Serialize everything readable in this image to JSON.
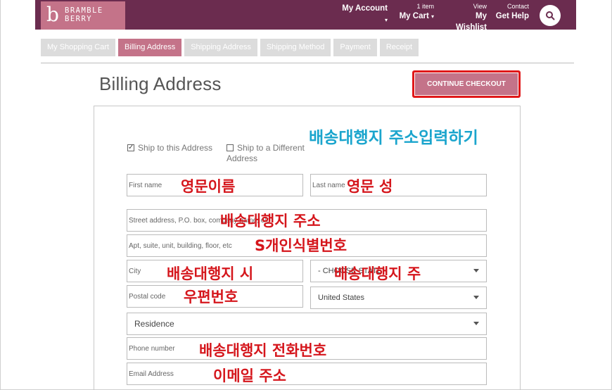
{
  "header": {
    "logo_mark": "b",
    "logo_line1": "BRAMBLE",
    "logo_line2": "BERRY",
    "account": {
      "top": "",
      "label": "My Account"
    },
    "cart": {
      "top": "1 item",
      "label": "My Cart"
    },
    "wishlist": {
      "top": "View",
      "label": "My Wishlist"
    },
    "help": {
      "top": "Contact",
      "label": "Get Help"
    },
    "caret": "▾"
  },
  "steps": [
    "My Shopping Cart",
    "Billing Address",
    "Shipping Address",
    "Shipping Method",
    "Payment",
    "Receipt"
  ],
  "active_step": 1,
  "page_title": "Billing Address",
  "continue_label": "CONTINUE CHECKOUT",
  "form": {
    "ship_same": "Ship to this Address",
    "ship_diff_1": "Ship to a Different",
    "ship_diff_2": "Address",
    "first_name": "First name",
    "last_name": "Last name",
    "street": "Street address, P.O. box, company name, c/o",
    "apt": "Apt, suite, unit, building, floor, etc",
    "city": "City",
    "state": "- CHOOSE STATE -",
    "postal": "Postal code",
    "country": "United States",
    "residence": "Residence",
    "phone": "Phone number",
    "email": "Email Address"
  },
  "annotations": {
    "title": "배송대행지 주소입력하기",
    "first_name": "영문이름",
    "last_name": "영문 성",
    "street": "배송대행지 주소",
    "apt": "S개인식별번호",
    "city": "배송대행지 시",
    "state": "배송대행지 주",
    "postal": "우편번호",
    "phone": "배송대행지 전화번호",
    "email": "이메일 주소"
  },
  "colors": {
    "header": "#6b2c4f",
    "accent": "#c47389",
    "annotation_red": "#d5161c",
    "annotation_blue": "#1ba5cd"
  }
}
